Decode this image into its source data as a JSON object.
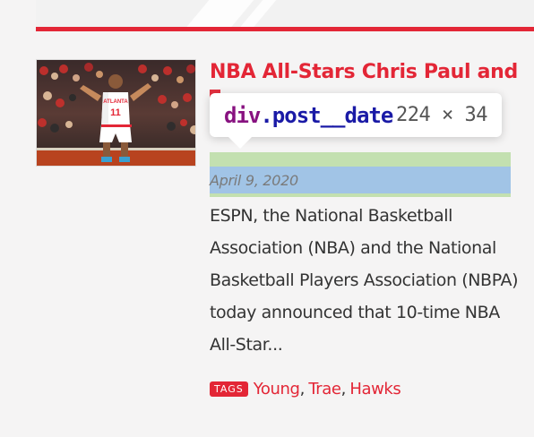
{
  "colors": {
    "accent": "#e32636",
    "link": "#e32636",
    "title": "#e32636",
    "text": "#333333",
    "date": "#7a7a7a",
    "tooltip_tag": "#881280",
    "tooltip_class": "#1a1aa6",
    "tooltip_dims": "#555555",
    "highlight_content": "#a1c4e6",
    "highlight_margin": "#c3e0b0",
    "tags_badge_bg": "#e32636",
    "tags_badge_text": "#ffffff"
  },
  "post": {
    "title": "NBA All-Stars Chris Paul and",
    "date": "April 9, 2020",
    "excerpt_lines": [
      "ESPN, the National Basketball",
      "Association (NBA) and the National",
      "Basketball Players Association (NBPA)",
      "today announced that 10-time NBA",
      "All-Star..."
    ],
    "thumbnail": {
      "jersey_text": "ATLANTA",
      "jersey_number": "11"
    },
    "tags_label": "TAGS",
    "tags": [
      "Young",
      "Trae",
      "Hawks"
    ],
    "tag_separator": ","
  },
  "devtools_tooltip": {
    "tag": "div",
    "class": ".post__date",
    "dimensions": "224 × 34"
  }
}
